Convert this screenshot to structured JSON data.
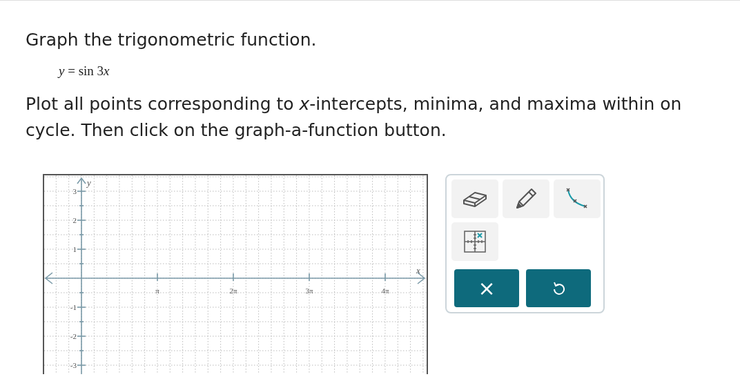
{
  "title": "Graph the trigonometric function.",
  "equation": [
    {
      "text": "y",
      "italic": true
    },
    {
      "text": " = sin 3",
      "italic": false
    },
    {
      "text": "x",
      "italic": true
    }
  ],
  "instructions": [
    "Plot all points corresponding to *x*-intercepts, minima, and maxima within on",
    "cycle. Then click on the graph-a-function button."
  ],
  "graph": {
    "x_axis_label": "x",
    "y_axis_label": "y",
    "x_ticks": [
      "π",
      "2π",
      "3π",
      "4π"
    ],
    "y_ticks": [
      "3",
      "2",
      "1",
      "-1",
      "-2",
      "-3"
    ]
  },
  "tools": [
    {
      "kind": "eraser"
    },
    {
      "kind": "pencil"
    },
    {
      "kind": "curve"
    },
    {
      "kind": "point-grid"
    }
  ],
  "actions": [
    {
      "kind": "clear",
      "label": "×"
    },
    {
      "kind": "undo"
    }
  ]
}
